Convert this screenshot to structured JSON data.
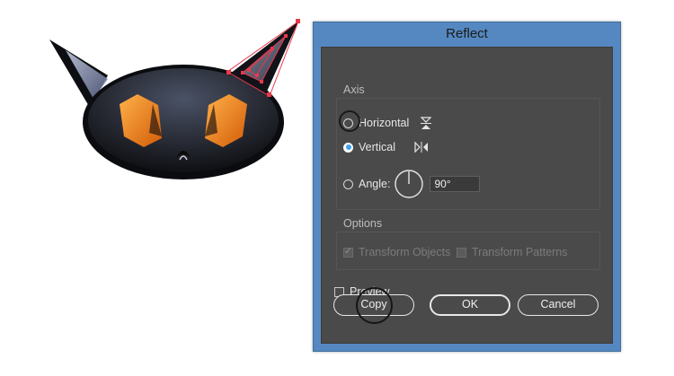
{
  "dialog": {
    "title": "Reflect",
    "axis": {
      "heading": "Axis",
      "horizontal_label": "Horizontal",
      "vertical_label": "Vertical",
      "angle_label": "Angle:",
      "angle_value": "90°",
      "selected": "vertical"
    },
    "options": {
      "heading": "Options",
      "transform_objects_label": "Transform Objects",
      "transform_objects_checked": true,
      "transform_patterns_label": "Transform Patterns",
      "transform_patterns_checked": false
    },
    "preview_label": "Preview",
    "preview_checked": false,
    "buttons": {
      "copy": "Copy",
      "ok": "OK",
      "cancel": "Cancel"
    }
  },
  "colors": {
    "title_bar": "#5588c0",
    "panel": "#4a4a4a",
    "selection": "#e8394b",
    "cat_eye": "#f08a1e",
    "cat_head": "#25272e"
  },
  "icons": [
    "reflect-horizontal-icon",
    "reflect-vertical-icon",
    "angle-dial-icon"
  ]
}
